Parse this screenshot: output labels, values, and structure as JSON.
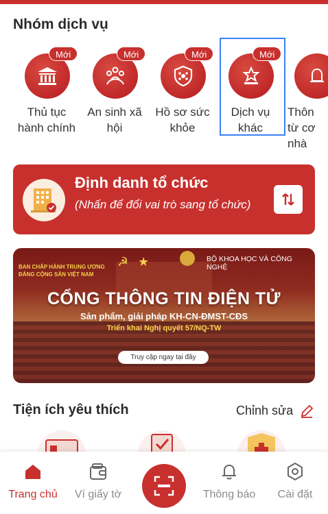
{
  "service_group": {
    "title": "Nhóm dịch vụ",
    "items": [
      {
        "label_line1": "Thủ tục",
        "label_line2": "hành chính",
        "badge": "Mới",
        "icon": "bank-icon"
      },
      {
        "label_line1": "An sinh xã",
        "label_line2": "hội",
        "badge": "Mới",
        "icon": "family-icon"
      },
      {
        "label_line1": "Hồ sơ sức",
        "label_line2": "khỏe",
        "badge": "Mới",
        "icon": "health-shield-icon"
      },
      {
        "label_line1": "Dịch vụ",
        "label_line2": "khác",
        "badge": "Mới",
        "icon": "star-podium-icon"
      },
      {
        "label_line1": "Thôn",
        "label_line2": "từ cơ",
        "label_line3": "nhà",
        "icon": "bell-icon"
      }
    ]
  },
  "org_identity": {
    "title": "Định danh tổ chức",
    "subtitle": "(Nhấn để đổi vai trò sang tổ chức)"
  },
  "banner": {
    "left_top": "BAN CHẤP HÀNH TRUNG ƯƠNG\nĐẢNG CỘNG SẢN VIỆT NAM",
    "right_top": "BỘ KHOA HỌC VÀ CÔNG NGHỆ",
    "title": "CỔNG THÔNG TIN ĐIỆN TỬ",
    "subtitle": "Sản phẩm, giải pháp KH-CN-ĐMST-CĐS",
    "subtitle2": "Triển khai Nghị quyết 57/NQ-TW",
    "cta": "Truy cập ngay tại đây"
  },
  "favorites": {
    "title": "Tiện ích yêu thích",
    "edit_label": "Chỉnh sửa"
  },
  "bottom_nav": {
    "home": "Trang chủ",
    "wallet": "Ví giấy tờ",
    "notifications": "Thông báo",
    "settings": "Cài đặt"
  },
  "colors": {
    "primary": "#c8302e",
    "selection": "#3b82f6"
  }
}
